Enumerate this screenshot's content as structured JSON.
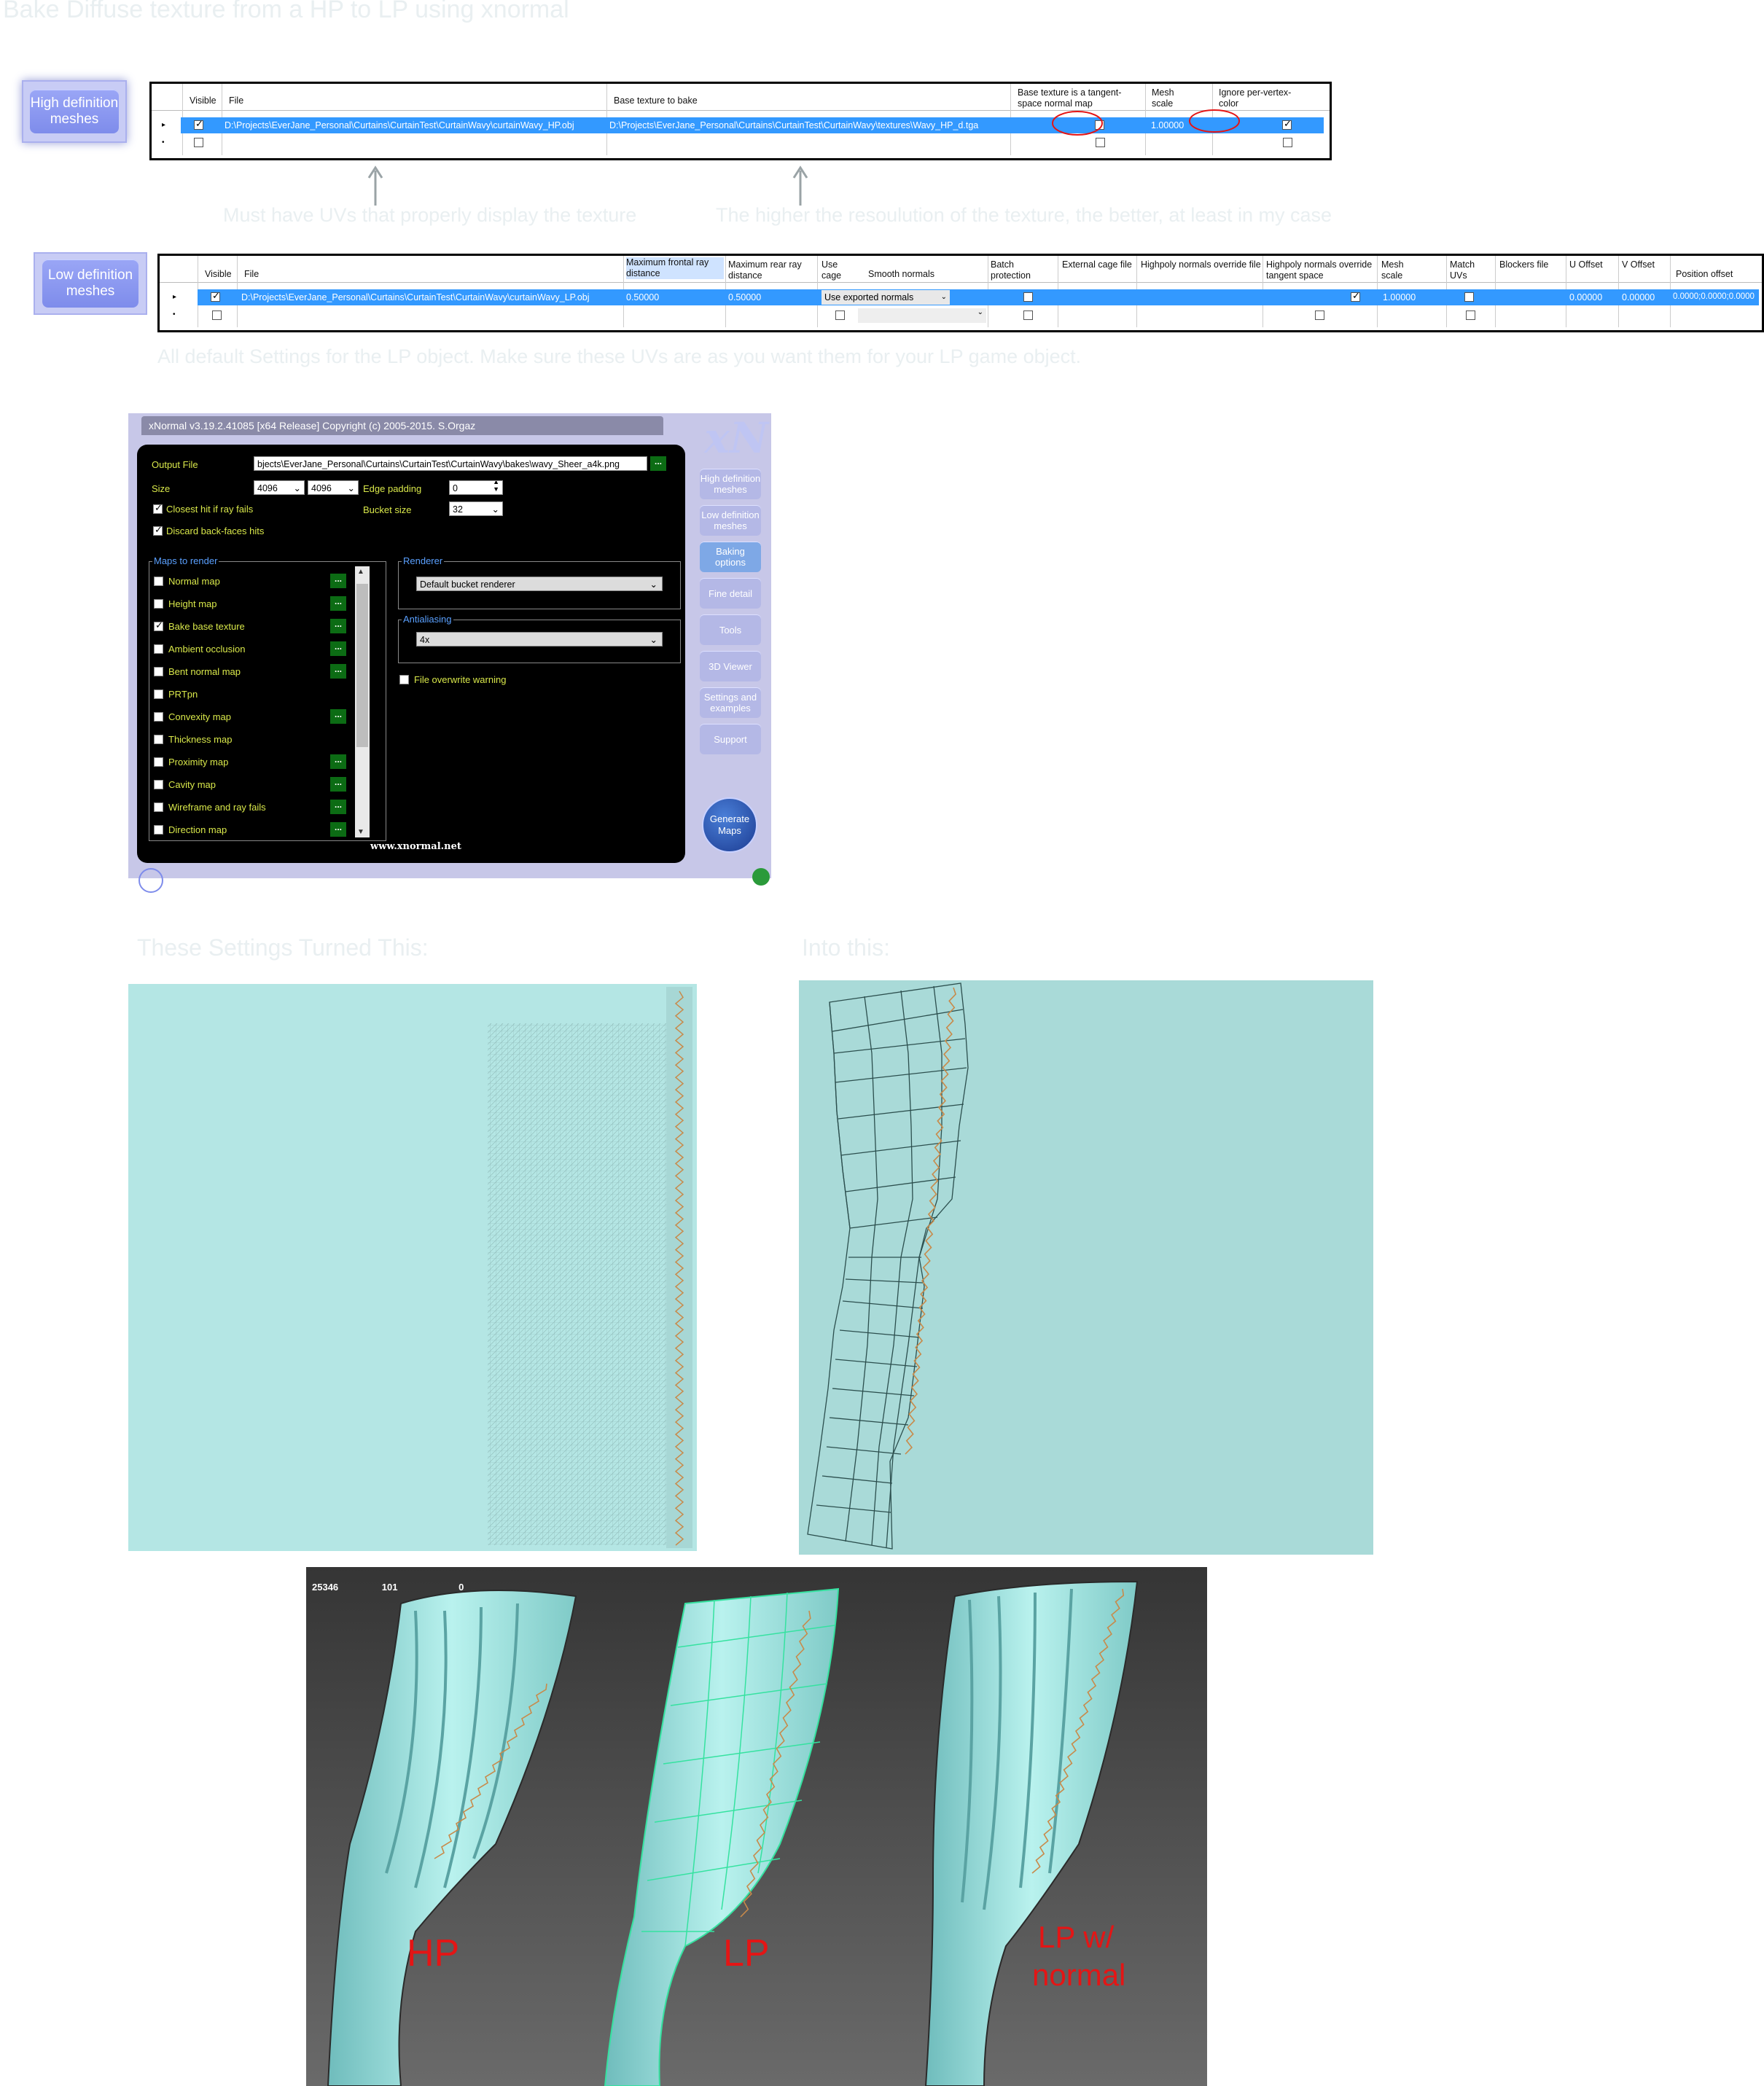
{
  "page_title": "Bake Diffuse texture from a HP to LP using xnormal",
  "hp_section": {
    "button": "High definition meshes",
    "headers": {
      "visible": "Visible",
      "file": "File",
      "base_texture": "Base texture to bake",
      "tangent_space": "Base texture is a tangent-space normal map",
      "mesh_scale": "Mesh scale",
      "ignore_vertex": "Ignore per-vertex-color"
    },
    "row": {
      "file": "D:\\Projects\\EverJane_Personal\\Curtains\\CurtainTest\\CurtainWavy\\curtainWavy_HP.obj",
      "base_texture": "D:\\Projects\\EverJane_Personal\\Curtains\\CurtainTest\\CurtainWavy\\textures\\Wavy_HP_d.tga",
      "mesh_scale": "1.00000"
    },
    "note_left": "Must have UVs that properly display the texture",
    "note_right": "The higher the resoulution of the texture, the better, at least in my case"
  },
  "lp_section": {
    "button": "Low definition meshes",
    "headers": {
      "visible": "Visible",
      "file": "File",
      "max_front": "Maximum frontal ray distance",
      "max_rear": "Maximum rear ray distance",
      "use_cage": "Use cage",
      "smooth_normals": "Smooth normals",
      "batch": "Batch protection",
      "ext_cage": "External cage file",
      "hp_override": "Highpoly normals override file",
      "hp_tangent": "Highpoly normals override tangent space",
      "mesh_scale": "Mesh scale",
      "match_uvs": "Match UVs",
      "blockers": "Blockers file",
      "u_offset": "U Offset",
      "v_offset": "V Offset",
      "pos_offset": "Position offset"
    },
    "row": {
      "file": "D:\\Projects\\EverJane_Personal\\Curtains\\CurtainTest\\CurtainWavy\\curtainWavy_LP.obj",
      "max_front": "0.50000",
      "max_rear": "0.50000",
      "smooth_normals": "Use exported normals",
      "mesh_scale": "1.00000",
      "u_offset": "0.00000",
      "v_offset": "0.00000",
      "pos_offset": "0.0000;0.0000;0.0000"
    },
    "note": "All default Settings for the LP object. Make sure these UVs are as you want them for your LP game object."
  },
  "xnormal": {
    "title": "xNormal v3.19.2.41085 [x64 Release] Copyright (c) 2005-2015. S.Orgaz",
    "logo": "xN",
    "output_label": "Output File",
    "output_value": "bjects\\EverJane_Personal\\Curtains\\CurtainTest\\CurtainWavy\\bakes\\wavy_Sheer_a4k.png",
    "size_label": "Size",
    "size_w": "4096",
    "size_h": "4096",
    "edge_label": "Edge padding",
    "edge_value": "0",
    "bucket_label": "Bucket size",
    "bucket_value": "32",
    "closest_hit": "Closest hit if ray fails",
    "discard_back": "Discard back-faces hits",
    "maps_group": "Maps to render",
    "maps": [
      {
        "label": "Normal map",
        "checked": false
      },
      {
        "label": "Height map",
        "checked": false
      },
      {
        "label": "Bake base texture",
        "checked": true
      },
      {
        "label": "Ambient occlusion",
        "checked": false
      },
      {
        "label": "Bent normal map",
        "checked": false
      },
      {
        "label": "PRTpn",
        "checked": false
      },
      {
        "label": "Convexity map",
        "checked": false
      },
      {
        "label": "Thickness map",
        "checked": false
      },
      {
        "label": "Proximity map",
        "checked": false
      },
      {
        "label": "Cavity map",
        "checked": false
      },
      {
        "label": "Wireframe and ray fails",
        "checked": false
      },
      {
        "label": "Direction map",
        "checked": false
      }
    ],
    "renderer_group": "Renderer",
    "renderer_value": "Default bucket renderer",
    "aa_group": "Antialiasing",
    "aa_value": "4x",
    "overwrite": "File overwrite warning",
    "footer": "www.xnormal.net",
    "nav": [
      "High definition meshes",
      "Low definition meshes",
      "Baking options",
      "Fine detail",
      "Tools",
      "3D Viewer",
      "Settings and examples",
      "Support"
    ],
    "generate": "Generate Maps",
    "more_button": "..."
  },
  "compare": {
    "left_caption": "These Settings Turned This:",
    "right_caption": "Into this:"
  },
  "viewport": {
    "stats_row": [
      "25346",
      "101",
      "0"
    ],
    "label_hp": "HP",
    "label_lp": "LP",
    "label_lpn_1": "LP w/",
    "label_lpn_2": "normal"
  },
  "colors": {
    "caption": "#e9eff1",
    "selection_blue": "#3399ff",
    "uv_bg": "#b3e5e3",
    "label_red": "#e41515"
  }
}
